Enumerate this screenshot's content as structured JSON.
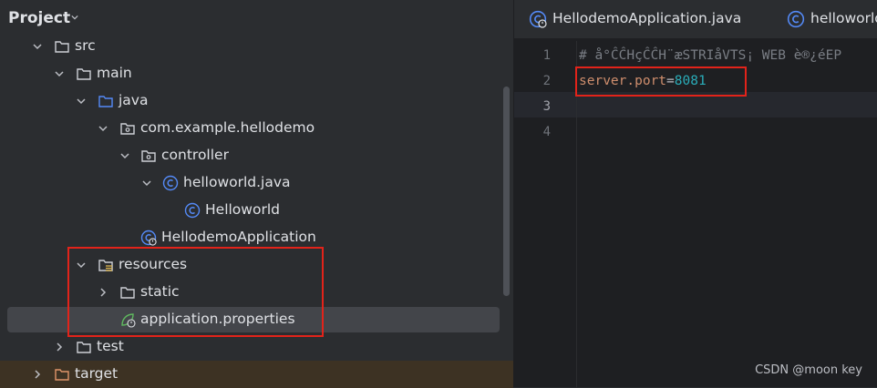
{
  "project_panel": {
    "title": "Project"
  },
  "tree": {
    "src": "src",
    "main": "main",
    "java": "java",
    "package": "com.example.hellodemo",
    "controller": "controller",
    "helloworld_file": "helloworld.java",
    "helloworld_class": "Helloworld",
    "app_class": "HellodemoApplication",
    "resources": "resources",
    "static": "static",
    "properties": "application.properties",
    "test": "test",
    "target": "target"
  },
  "editor": {
    "tabs": [
      {
        "label": "HellodemoApplication.java"
      },
      {
        "label": "helloworld"
      }
    ],
    "line_numbers": [
      "1",
      "2",
      "3",
      "4"
    ],
    "line1_comment": "# å°ĈĈHçĈĈH¨æSTRIåVTS¡ WEB è®¿éEP",
    "line2_key": "server.port",
    "line2_eq": "=",
    "line2_value": "8081"
  },
  "watermark": "CSDN @moon key",
  "colors": {
    "highlight_box": "#e2231a",
    "folder_blue": "#548af7",
    "target_folder": "#e0956a",
    "selected_row": "#43454a"
  }
}
